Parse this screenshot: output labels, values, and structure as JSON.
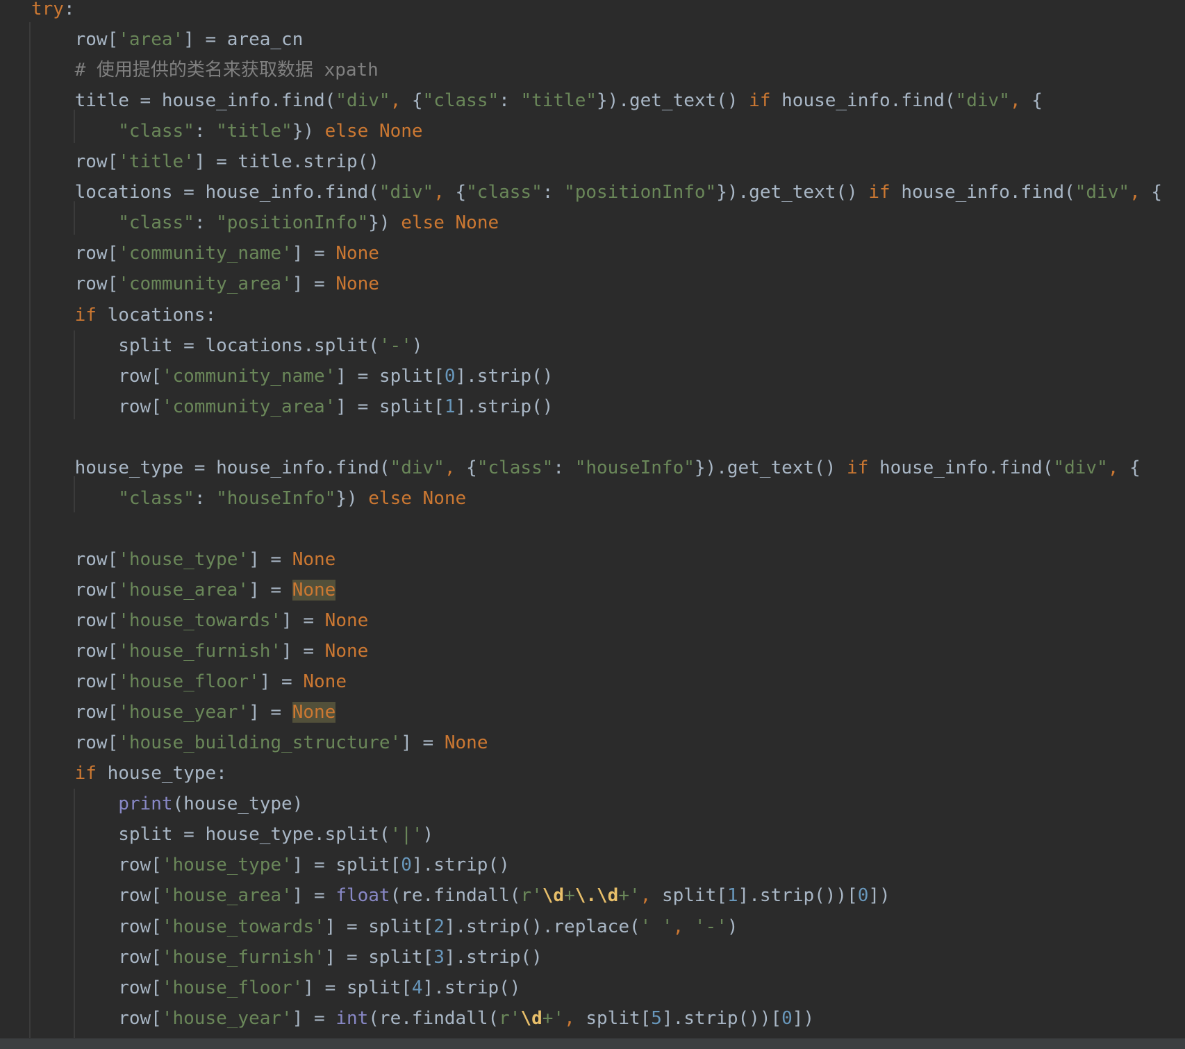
{
  "editor": {
    "language": "python",
    "theme_colors": {
      "background": "#2b2b2b",
      "plain": "#a9b7c6",
      "keyword": "#cc7832",
      "string": "#6a8759",
      "comment": "#808080",
      "number": "#6897bb",
      "builtin": "#8888c6",
      "regex_escape": "#e8bf6a",
      "occurrence_highlight": "#52503a"
    },
    "lines": [
      [
        [
          "kw",
          "try"
        ],
        [
          "p",
          ":"
        ]
      ],
      [
        [
          "p",
          "    row["
        ],
        [
          "s",
          "'area'"
        ],
        [
          "p",
          "] = area_cn"
        ]
      ],
      [
        [
          "c",
          "    # 使用提供的类名来获取数据 xpath"
        ]
      ],
      [
        [
          "p",
          "    title = house_info.find("
        ],
        [
          "s",
          "\"div\""
        ],
        [
          "kw",
          ", "
        ],
        [
          "p",
          "{"
        ],
        [
          "s",
          "\"class\""
        ],
        [
          "p",
          ": "
        ],
        [
          "s",
          "\"title\""
        ],
        [
          "p",
          "}).get_text() "
        ],
        [
          "kw",
          "if "
        ],
        [
          "p",
          "house_info.find("
        ],
        [
          "s",
          "\"div\""
        ],
        [
          "kw",
          ", "
        ],
        [
          "p",
          "{"
        ]
      ],
      [
        [
          "p",
          "        "
        ],
        [
          "s",
          "\"class\""
        ],
        [
          "p",
          ": "
        ],
        [
          "s",
          "\"title\""
        ],
        [
          "p",
          "}) "
        ],
        [
          "kw",
          "else None"
        ]
      ],
      [
        [
          "p",
          "    row["
        ],
        [
          "s",
          "'title'"
        ],
        [
          "p",
          "] = title.strip()"
        ]
      ],
      [
        [
          "p",
          "    locations = house_info.find("
        ],
        [
          "s",
          "\"div\""
        ],
        [
          "kw",
          ", "
        ],
        [
          "p",
          "{"
        ],
        [
          "s",
          "\"class\""
        ],
        [
          "p",
          ": "
        ],
        [
          "s",
          "\"positionInfo\""
        ],
        [
          "p",
          "}).get_text() "
        ],
        [
          "kw",
          "if "
        ],
        [
          "p",
          "house_info.find("
        ],
        [
          "s",
          "\"div\""
        ],
        [
          "kw",
          ", "
        ],
        [
          "p",
          "{"
        ]
      ],
      [
        [
          "p",
          "        "
        ],
        [
          "s",
          "\"class\""
        ],
        [
          "p",
          ": "
        ],
        [
          "s",
          "\"positionInfo\""
        ],
        [
          "p",
          "}) "
        ],
        [
          "kw",
          "else None"
        ]
      ],
      [
        [
          "p",
          "    row["
        ],
        [
          "s",
          "'community_name'"
        ],
        [
          "p",
          "] = "
        ],
        [
          "kw",
          "None"
        ]
      ],
      [
        [
          "p",
          "    row["
        ],
        [
          "s",
          "'community_area'"
        ],
        [
          "p",
          "] = "
        ],
        [
          "kw",
          "None"
        ]
      ],
      [
        [
          "kw",
          "    if "
        ],
        [
          "p",
          "locations:"
        ]
      ],
      [
        [
          "p",
          "        split = locations.split("
        ],
        [
          "s",
          "'-'"
        ],
        [
          "p",
          ")"
        ]
      ],
      [
        [
          "p",
          "        row["
        ],
        [
          "s",
          "'community_name'"
        ],
        [
          "p",
          "] = split["
        ],
        [
          "n",
          "0"
        ],
        [
          "p",
          "].strip()"
        ]
      ],
      [
        [
          "p",
          "        row["
        ],
        [
          "s",
          "'community_area'"
        ],
        [
          "p",
          "] = split["
        ],
        [
          "n",
          "1"
        ],
        [
          "p",
          "].strip()"
        ]
      ],
      [],
      [
        [
          "p",
          "    house_type = house_info.find("
        ],
        [
          "s",
          "\"div\""
        ],
        [
          "kw",
          ", "
        ],
        [
          "p",
          "{"
        ],
        [
          "s",
          "\"class\""
        ],
        [
          "p",
          ": "
        ],
        [
          "s",
          "\"houseInfo\""
        ],
        [
          "p",
          "}).get_text() "
        ],
        [
          "kw",
          "if "
        ],
        [
          "p",
          "house_info.find("
        ],
        [
          "s",
          "\"div\""
        ],
        [
          "kw",
          ", "
        ],
        [
          "p",
          "{"
        ]
      ],
      [
        [
          "p",
          "        "
        ],
        [
          "s",
          "\"class\""
        ],
        [
          "p",
          ": "
        ],
        [
          "s",
          "\"houseInfo\""
        ],
        [
          "p",
          "}) "
        ],
        [
          "kw",
          "else None"
        ]
      ],
      [],
      [
        [
          "p",
          "    row["
        ],
        [
          "s",
          "'house_type'"
        ],
        [
          "p",
          "] = "
        ],
        [
          "kw",
          "None"
        ]
      ],
      [
        [
          "p",
          "    row["
        ],
        [
          "s",
          "'house_area'"
        ],
        [
          "p",
          "] = "
        ],
        [
          "nh",
          "None"
        ]
      ],
      [
        [
          "p",
          "    row["
        ],
        [
          "s",
          "'house_towards'"
        ],
        [
          "p",
          "] = "
        ],
        [
          "kw",
          "None"
        ]
      ],
      [
        [
          "p",
          "    row["
        ],
        [
          "s",
          "'house_furnish'"
        ],
        [
          "p",
          "] = "
        ],
        [
          "kw",
          "None"
        ]
      ],
      [
        [
          "p",
          "    row["
        ],
        [
          "s",
          "'house_floor'"
        ],
        [
          "p",
          "] = "
        ],
        [
          "kw",
          "None"
        ]
      ],
      [
        [
          "p",
          "    row["
        ],
        [
          "s",
          "'house_year'"
        ],
        [
          "p",
          "] = "
        ],
        [
          "nh",
          "None"
        ]
      ],
      [
        [
          "p",
          "    row["
        ],
        [
          "s",
          "'house_building_structure'"
        ],
        [
          "p",
          "] = "
        ],
        [
          "kw",
          "None"
        ]
      ],
      [
        [
          "kw",
          "    if "
        ],
        [
          "p",
          "house_type:"
        ]
      ],
      [
        [
          "p",
          "        "
        ],
        [
          "b",
          "print"
        ],
        [
          "p",
          "(house_type)"
        ]
      ],
      [
        [
          "p",
          "        split = house_type.split("
        ],
        [
          "s",
          "'|'"
        ],
        [
          "p",
          ")"
        ]
      ],
      [
        [
          "p",
          "        row["
        ],
        [
          "s",
          "'house_type'"
        ],
        [
          "p",
          "] = split["
        ],
        [
          "n",
          "0"
        ],
        [
          "p",
          "].strip()"
        ]
      ],
      [
        [
          "p",
          "        row["
        ],
        [
          "s",
          "'house_area'"
        ],
        [
          "p",
          "] = "
        ],
        [
          "b",
          "float"
        ],
        [
          "p",
          "(re.findall("
        ],
        [
          "s",
          "r'"
        ],
        [
          "re",
          "\\d"
        ],
        [
          "s",
          "+"
        ],
        [
          "re",
          "\\."
        ],
        [
          "re",
          "\\d"
        ],
        [
          "s",
          "+'"
        ],
        [
          "kw",
          ", "
        ],
        [
          "p",
          "split["
        ],
        [
          "n",
          "1"
        ],
        [
          "p",
          "].strip())["
        ],
        [
          "n",
          "0"
        ],
        [
          "p",
          "])"
        ]
      ],
      [
        [
          "p",
          "        row["
        ],
        [
          "s",
          "'house_towards'"
        ],
        [
          "p",
          "] = split["
        ],
        [
          "n",
          "2"
        ],
        [
          "p",
          "].strip().replace("
        ],
        [
          "s",
          "' '"
        ],
        [
          "kw",
          ", "
        ],
        [
          "s",
          "'-'"
        ],
        [
          "p",
          ")"
        ]
      ],
      [
        [
          "p",
          "        row["
        ],
        [
          "s",
          "'house_furnish'"
        ],
        [
          "p",
          "] = split["
        ],
        [
          "n",
          "3"
        ],
        [
          "p",
          "].strip()"
        ]
      ],
      [
        [
          "p",
          "        row["
        ],
        [
          "s",
          "'house_floor'"
        ],
        [
          "p",
          "] = split["
        ],
        [
          "n",
          "4"
        ],
        [
          "p",
          "].strip()"
        ]
      ],
      [
        [
          "p",
          "        row["
        ],
        [
          "s",
          "'house_year'"
        ],
        [
          "p",
          "] = "
        ],
        [
          "b",
          "int"
        ],
        [
          "p",
          "(re.findall("
        ],
        [
          "s",
          "r'"
        ],
        [
          "re",
          "\\d"
        ],
        [
          "s",
          "+'"
        ],
        [
          "kw",
          ", "
        ],
        [
          "p",
          "split["
        ],
        [
          "n",
          "5"
        ],
        [
          "p",
          "].strip())["
        ],
        [
          "n",
          "0"
        ],
        [
          "p",
          "])"
        ]
      ]
    ]
  }
}
